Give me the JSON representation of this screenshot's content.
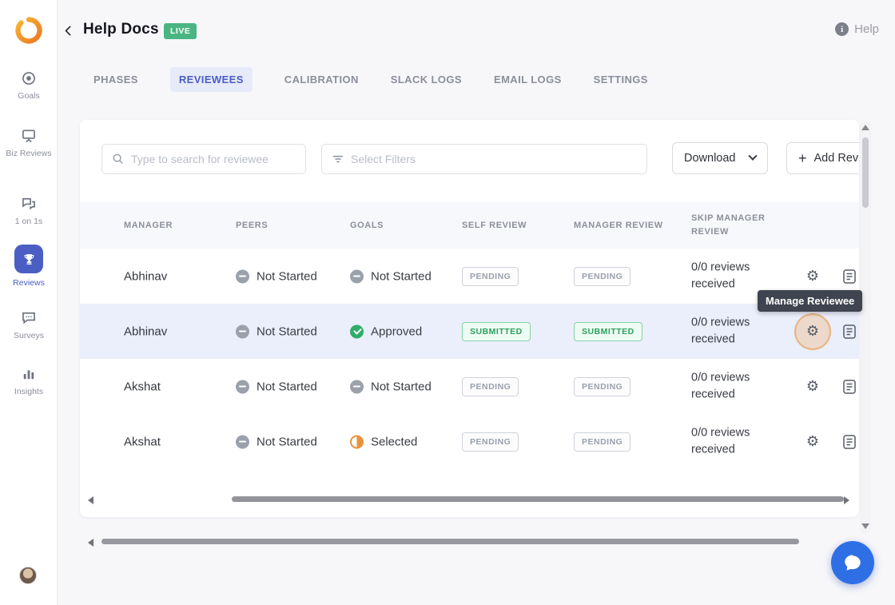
{
  "colors": {
    "accent": "#4a5ec4",
    "live_green": "#4ab582",
    "submitted_green": "#2aa05f",
    "pending_gray": "#9aa0ab",
    "selected_orange": "#e8923e",
    "chat_blue": "#2f6fe5",
    "highlight_row": "#ebeefb"
  },
  "sidebar": {
    "items": [
      {
        "label": "Goals"
      },
      {
        "label": "Biz Reviews"
      },
      {
        "label": "1 on 1s"
      },
      {
        "label": "Reviews",
        "active": true
      },
      {
        "label": "Surveys"
      },
      {
        "label": "Insights"
      }
    ]
  },
  "header": {
    "title": "Help Docs",
    "live_badge": "LIVE",
    "help_label": "Help"
  },
  "tabs": {
    "active": "REVIEWEES",
    "items": [
      {
        "label": "PHASES"
      },
      {
        "label": "REVIEWEES"
      },
      {
        "label": "CALIBRATION"
      },
      {
        "label": "SLACK LOGS"
      },
      {
        "label": "EMAIL LOGS"
      },
      {
        "label": "SETTINGS"
      }
    ]
  },
  "toolbar": {
    "search_placeholder": "Type to search for reviewee",
    "filter_placeholder": "Select Filters",
    "download_label": "Download",
    "add_icon": "+",
    "add_label": "Add Rev"
  },
  "table": {
    "headers": {
      "manager": "MANAGER",
      "peers": "PEERS",
      "goals": "GOALS",
      "self_review": "SELF REVIEW",
      "manager_review": "MANAGER REVIEW",
      "skip_manager_review": "SKIP MANAGER REVIEW"
    },
    "rows": [
      {
        "manager": "Abhinav",
        "peers": "Not Started",
        "peers_status": "not-started",
        "goals": "Not Started",
        "goals_status": "not-started",
        "self_review": "PENDING",
        "self_review_status": "pending",
        "manager_review": "PENDING",
        "manager_review_status": "pending",
        "skip": "0/0 reviews received",
        "highlighted": false
      },
      {
        "manager": "Abhinav",
        "peers": "Not Started",
        "peers_status": "not-started",
        "goals": "Approved",
        "goals_status": "approved",
        "self_review": "SUBMITTED",
        "self_review_status": "submitted",
        "manager_review": "SUBMITTED",
        "manager_review_status": "submitted",
        "skip": "0/0 reviews received",
        "highlighted": true
      },
      {
        "manager": "Akshat",
        "peers": "Not Started",
        "peers_status": "not-started",
        "goals": "Not Started",
        "goals_status": "not-started",
        "self_review": "PENDING",
        "self_review_status": "pending",
        "manager_review": "PENDING",
        "manager_review_status": "pending",
        "skip": "0/0 reviews received",
        "highlighted": false
      },
      {
        "manager": "Akshat",
        "peers": "Not Started",
        "peers_status": "not-started",
        "goals": "Selected",
        "goals_status": "selected",
        "self_review": "PENDING",
        "self_review_status": "pending",
        "manager_review": "PENDING",
        "manager_review_status": "pending",
        "skip": "0/0 reviews received",
        "highlighted": false
      }
    ]
  },
  "tooltip": {
    "label": "Manage Reviewee"
  }
}
